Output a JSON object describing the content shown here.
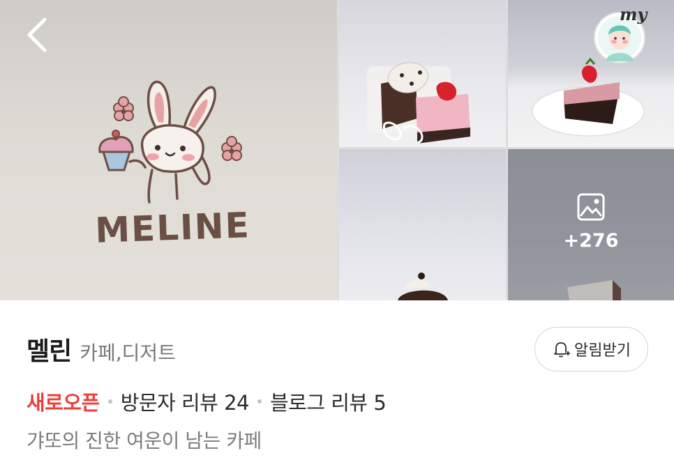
{
  "gallery": {
    "main_photo_brand": "MELINE",
    "more_count": "+276"
  },
  "header": {
    "my_label": "my"
  },
  "place": {
    "name": "멜린",
    "category": "카페,디저트",
    "alarm_label": "알림받기",
    "new_badge": "새로오픈",
    "visitor_reviews": "방문자 리뷰 24",
    "blog_reviews": "블로그 리뷰 5",
    "description": "갸또의 진한 여운이 남는 카페"
  },
  "colors": {
    "accent_red": "#ee3d3a",
    "brand_brown": "#6b4f45"
  }
}
